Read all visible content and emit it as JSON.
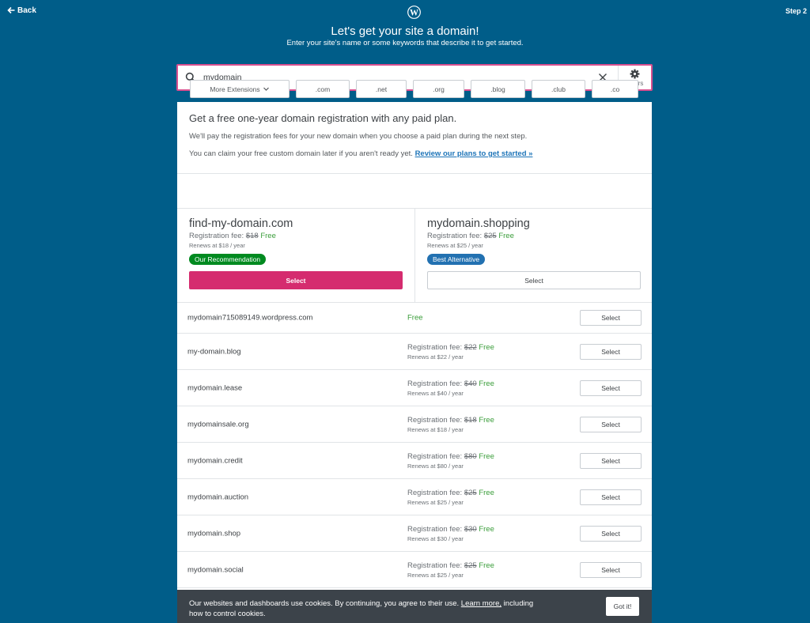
{
  "nav": {
    "back_label": "Back",
    "step_label": "Step 2"
  },
  "header": {
    "logo_icon": "wordpress-logo",
    "title": "Let's get your site a domain!",
    "subtitle": "Enter your site's name or some keywords that describe it to get started."
  },
  "search": {
    "value": "mydomain",
    "icon": "search-icon",
    "clear_icon": "close-icon",
    "filters_label": "Filters",
    "filters_icon": "gear-icon"
  },
  "promo": {
    "heading": "Get a free one-year domain registration with any paid plan.",
    "line1": "We'll pay the registration fees for your new domain when you choose a paid plan during the next step.",
    "line2": "You can claim your free custom domain later if you aren't ready yet.",
    "link": "Review our plans to get started »"
  },
  "tld_filters": {
    "more_label": "More Extensions",
    "items": [
      ".com",
      ".net",
      ".org",
      ".blog",
      ".club",
      ".co"
    ]
  },
  "featured": [
    {
      "domain": "find-my-domain.com",
      "fee_label": "Registration fee:",
      "old_price": "$18",
      "free_label": "Free",
      "renews": "Renews at $18 / year",
      "badge": "Our Recommendation",
      "button": "Select"
    },
    {
      "domain": "mydomain.shopping",
      "fee_label": "Registration fee:",
      "old_price": "$25",
      "free_label": "Free",
      "renews": "Renews at $25 / year",
      "badge": "Best Alternative",
      "button": "Select"
    }
  ],
  "results": [
    {
      "domain": "mydomain715089149.wordpress.com",
      "free_label": "Free",
      "button": "Select"
    },
    {
      "domain": "my-domain.blog",
      "fee_label": "Registration fee:",
      "old_price": "$22",
      "free_label": "Free",
      "renews": "Renews at $22 / year",
      "button": "Select"
    },
    {
      "domain": "mydomain.lease",
      "fee_label": "Registration fee:",
      "old_price": "$40",
      "free_label": "Free",
      "renews": "Renews at $40 / year",
      "button": "Select"
    },
    {
      "domain": "mydomainsale.org",
      "fee_label": "Registration fee:",
      "old_price": "$18",
      "free_label": "Free",
      "renews": "Renews at $18 / year",
      "button": "Select"
    },
    {
      "domain": "mydomain.credit",
      "fee_label": "Registration fee:",
      "old_price": "$80",
      "free_label": "Free",
      "renews": "Renews at $80 / year",
      "button": "Select"
    },
    {
      "domain": "mydomain.auction",
      "fee_label": "Registration fee:",
      "old_price": "$25",
      "free_label": "Free",
      "renews": "Renews at $25 / year",
      "button": "Select"
    },
    {
      "domain": "mydomain.shop",
      "fee_label": "Registration fee:",
      "old_price": "$30",
      "free_label": "Free",
      "renews": "Renews at $30 / year",
      "button": "Select"
    },
    {
      "domain": "mydomain.social",
      "fee_label": "Registration fee:",
      "old_price": "$25",
      "free_label": "Free",
      "renews": "Renews at $25 / year",
      "button": "Select"
    }
  ],
  "cookie": {
    "text": "Our websites and dashboards use cookies. By continuing, you agree to their use.",
    "link": "Learn more,",
    "text2": "including how to control cookies.",
    "button": "Got it!"
  },
  "colors": {
    "background": "#005d89",
    "primary_button": "#d52c6f",
    "free_text": "#3a9d3a",
    "badge_recommendation": "#008a20",
    "badge_alternative": "#2271b1",
    "link": "#1d74b8",
    "cookie_bar": "#3c434a"
  }
}
